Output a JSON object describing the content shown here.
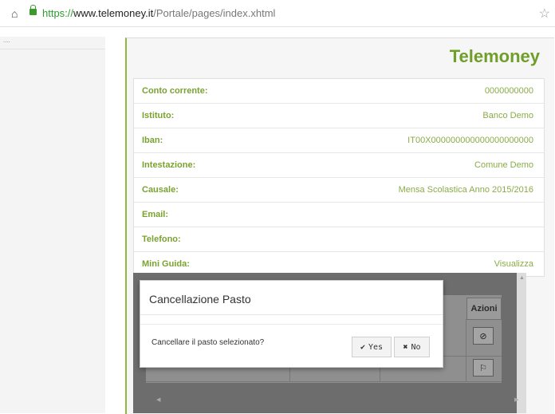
{
  "browser": {
    "url_https": "https://",
    "url_domain": "www.telemoney.it",
    "url_path": "/Portale/pages/index.xhtml"
  },
  "sidebar": {
    "marker": "...."
  },
  "header": {
    "brand": "Telemoney"
  },
  "info": [
    {
      "label": "Conto corrente:",
      "value": "0000000000"
    },
    {
      "label": "Istituto:",
      "value": "Banco Demo"
    },
    {
      "label": "Iban:",
      "value": "IT00X000000000000000000000"
    },
    {
      "label": "Intestazione:",
      "value": "Comune Demo"
    },
    {
      "label": "Causale:",
      "value": "Mensa Scolastica Anno 2015/2016"
    },
    {
      "label": "Email:",
      "value": ""
    },
    {
      "label": "Telefono:",
      "value": ""
    },
    {
      "label": "Mini Guida:",
      "value": "Visualizza"
    }
  ],
  "table": {
    "column_actions": "Azioni"
  },
  "dialog": {
    "title": "Cancellazione Pasto",
    "message": "Cancellare il pasto selezionato?",
    "yes_label": "Yes",
    "no_label": "No"
  },
  "colors": {
    "accent": "#6f9e2a",
    "label": "#7aa22f",
    "overlay": "#6d6d6d"
  }
}
